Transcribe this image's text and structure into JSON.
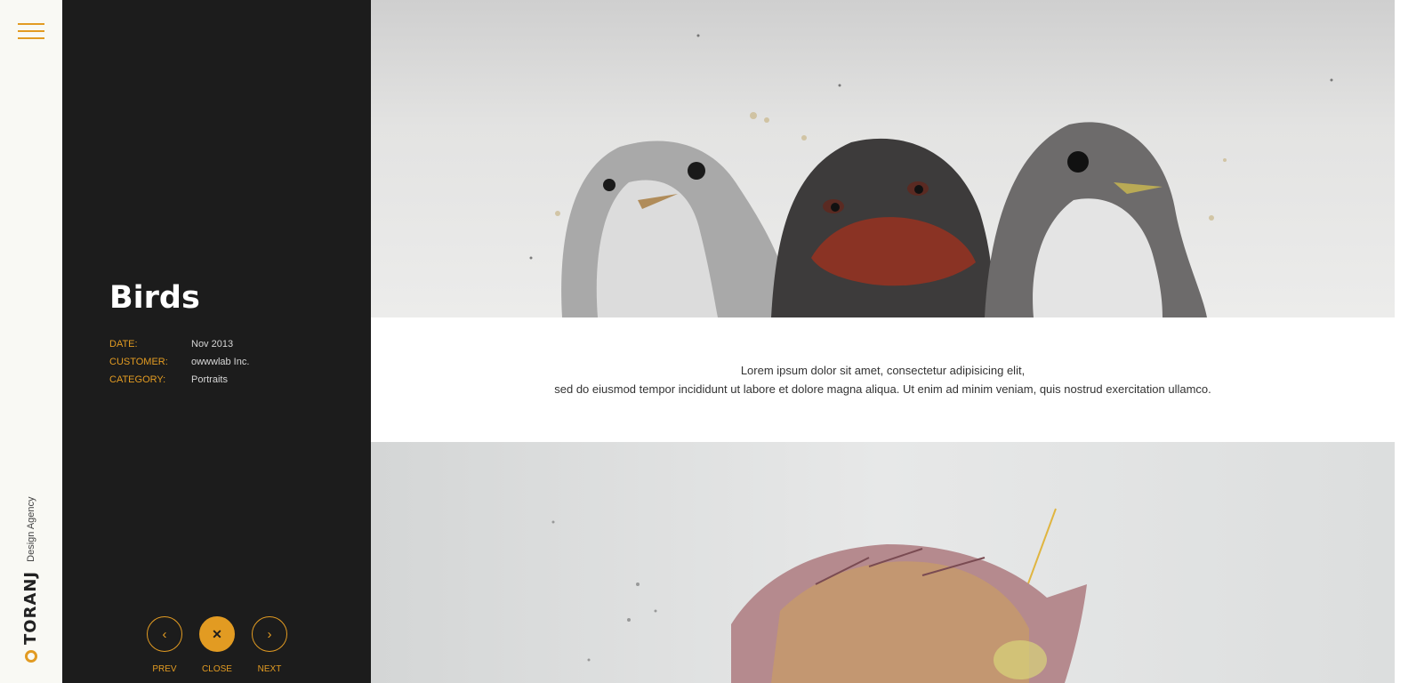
{
  "brand": {
    "name": "TORANJ",
    "tagline": "Design Agency"
  },
  "project": {
    "title": "Birds",
    "meta": [
      {
        "label": "DATE:",
        "value": "Nov 2013"
      },
      {
        "label": "CUSTOMER:",
        "value": "owwwlab Inc."
      },
      {
        "label": "CATEGORY:",
        "value": "Portraits"
      }
    ]
  },
  "nav": {
    "prev_label": "PREV",
    "close_label": "CLOSE",
    "next_label": "NEXT",
    "prev_icon": "‹",
    "close_icon": "✕",
    "next_icon": "›"
  },
  "content": {
    "line1": "Lorem ipsum dolor sit amet, consectetur adipisicing elit,",
    "line2": "sed do eiusmod tempor incididunt ut labore et dolore magna aliqua. Ut enim ad minim veniam, quis nostrud exercitation ullamco."
  },
  "colors": {
    "accent": "#e29b22",
    "panel": "#1c1c1c",
    "rail": "#f9f9f4"
  }
}
